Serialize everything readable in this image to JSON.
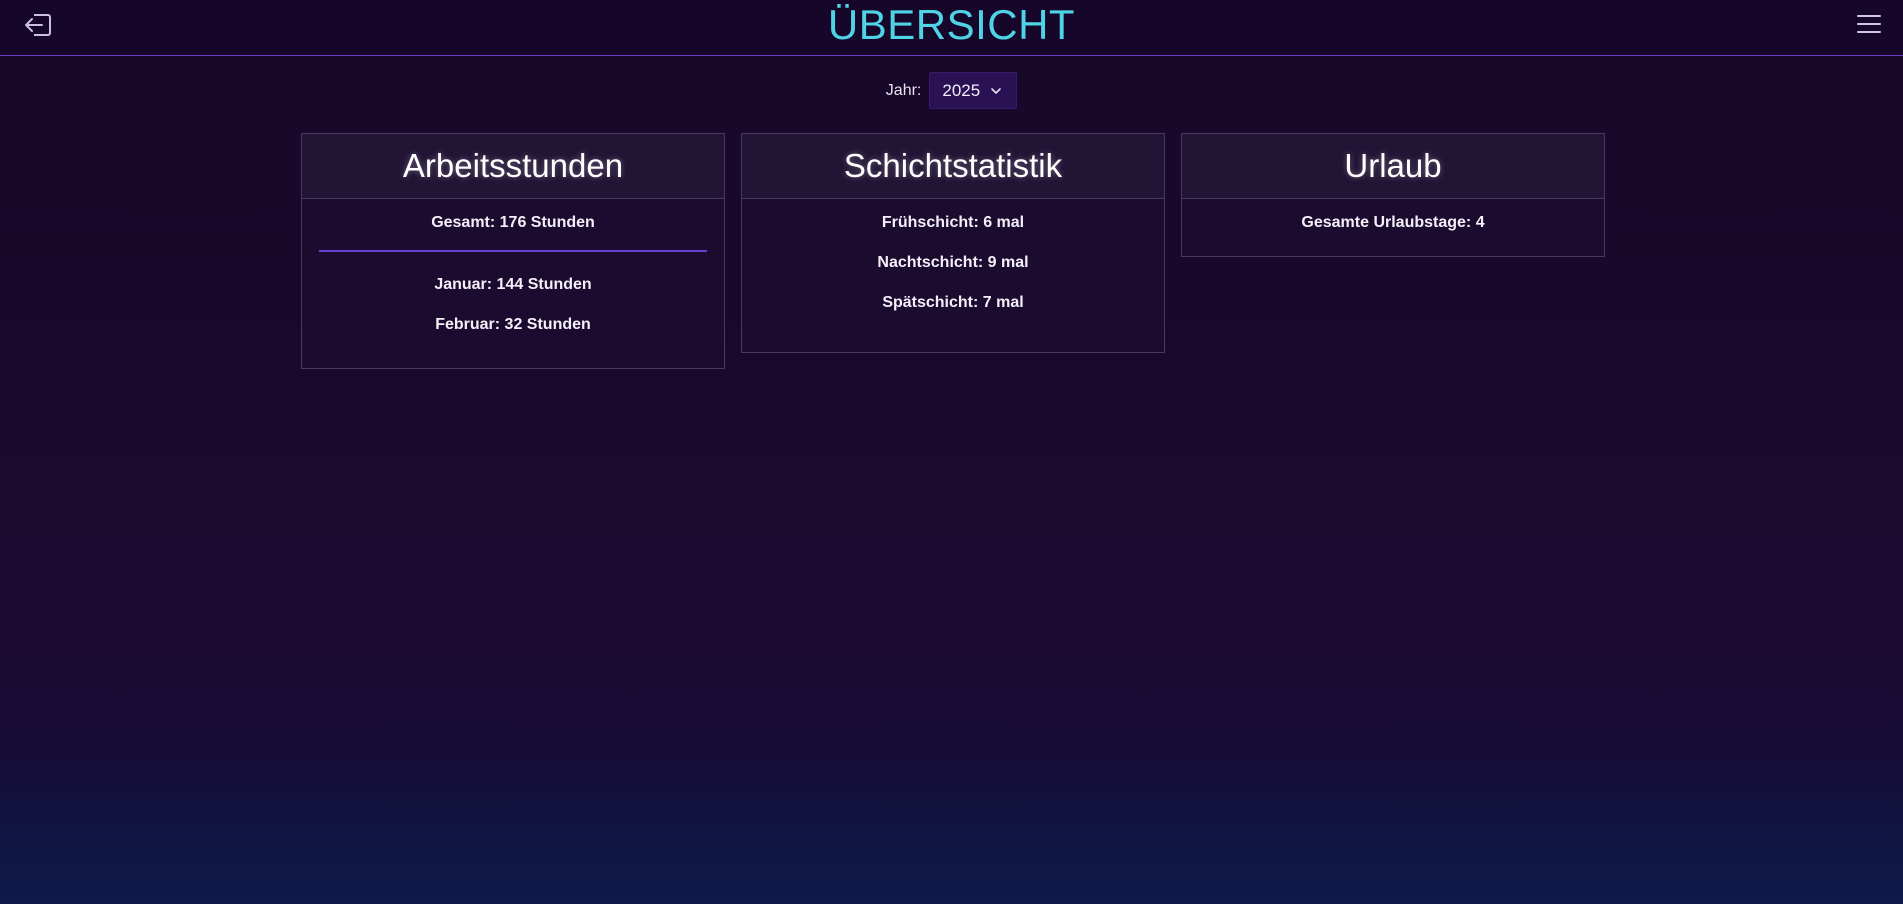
{
  "header": {
    "title": "ÜBERSICHT"
  },
  "year_filter": {
    "label": "Jahr:",
    "selected": "2025"
  },
  "cards": {
    "hours": {
      "title": "Arbeitsstunden",
      "total": "Gesamt: 176 Stunden",
      "months": [
        "Januar: 144 Stunden",
        "Februar: 32 Stunden"
      ]
    },
    "shifts": {
      "title": "Schichtstatistik",
      "items": [
        "Frühschicht: 6 mal",
        "Nachtschicht: 9 mal",
        "Spätschicht: 7 mal"
      ]
    },
    "vacation": {
      "title": "Urlaub",
      "total": "Gesamte Urlaubstage: 4"
    }
  },
  "icons": {
    "back": "logout-arrow-icon",
    "menu": "hamburger-menu-icon",
    "dropdown": "chevron-down-icon"
  },
  "colors": {
    "accent": "#4fd3e6",
    "divider": "#6b3fd0",
    "select_bg": "#2a1154"
  }
}
